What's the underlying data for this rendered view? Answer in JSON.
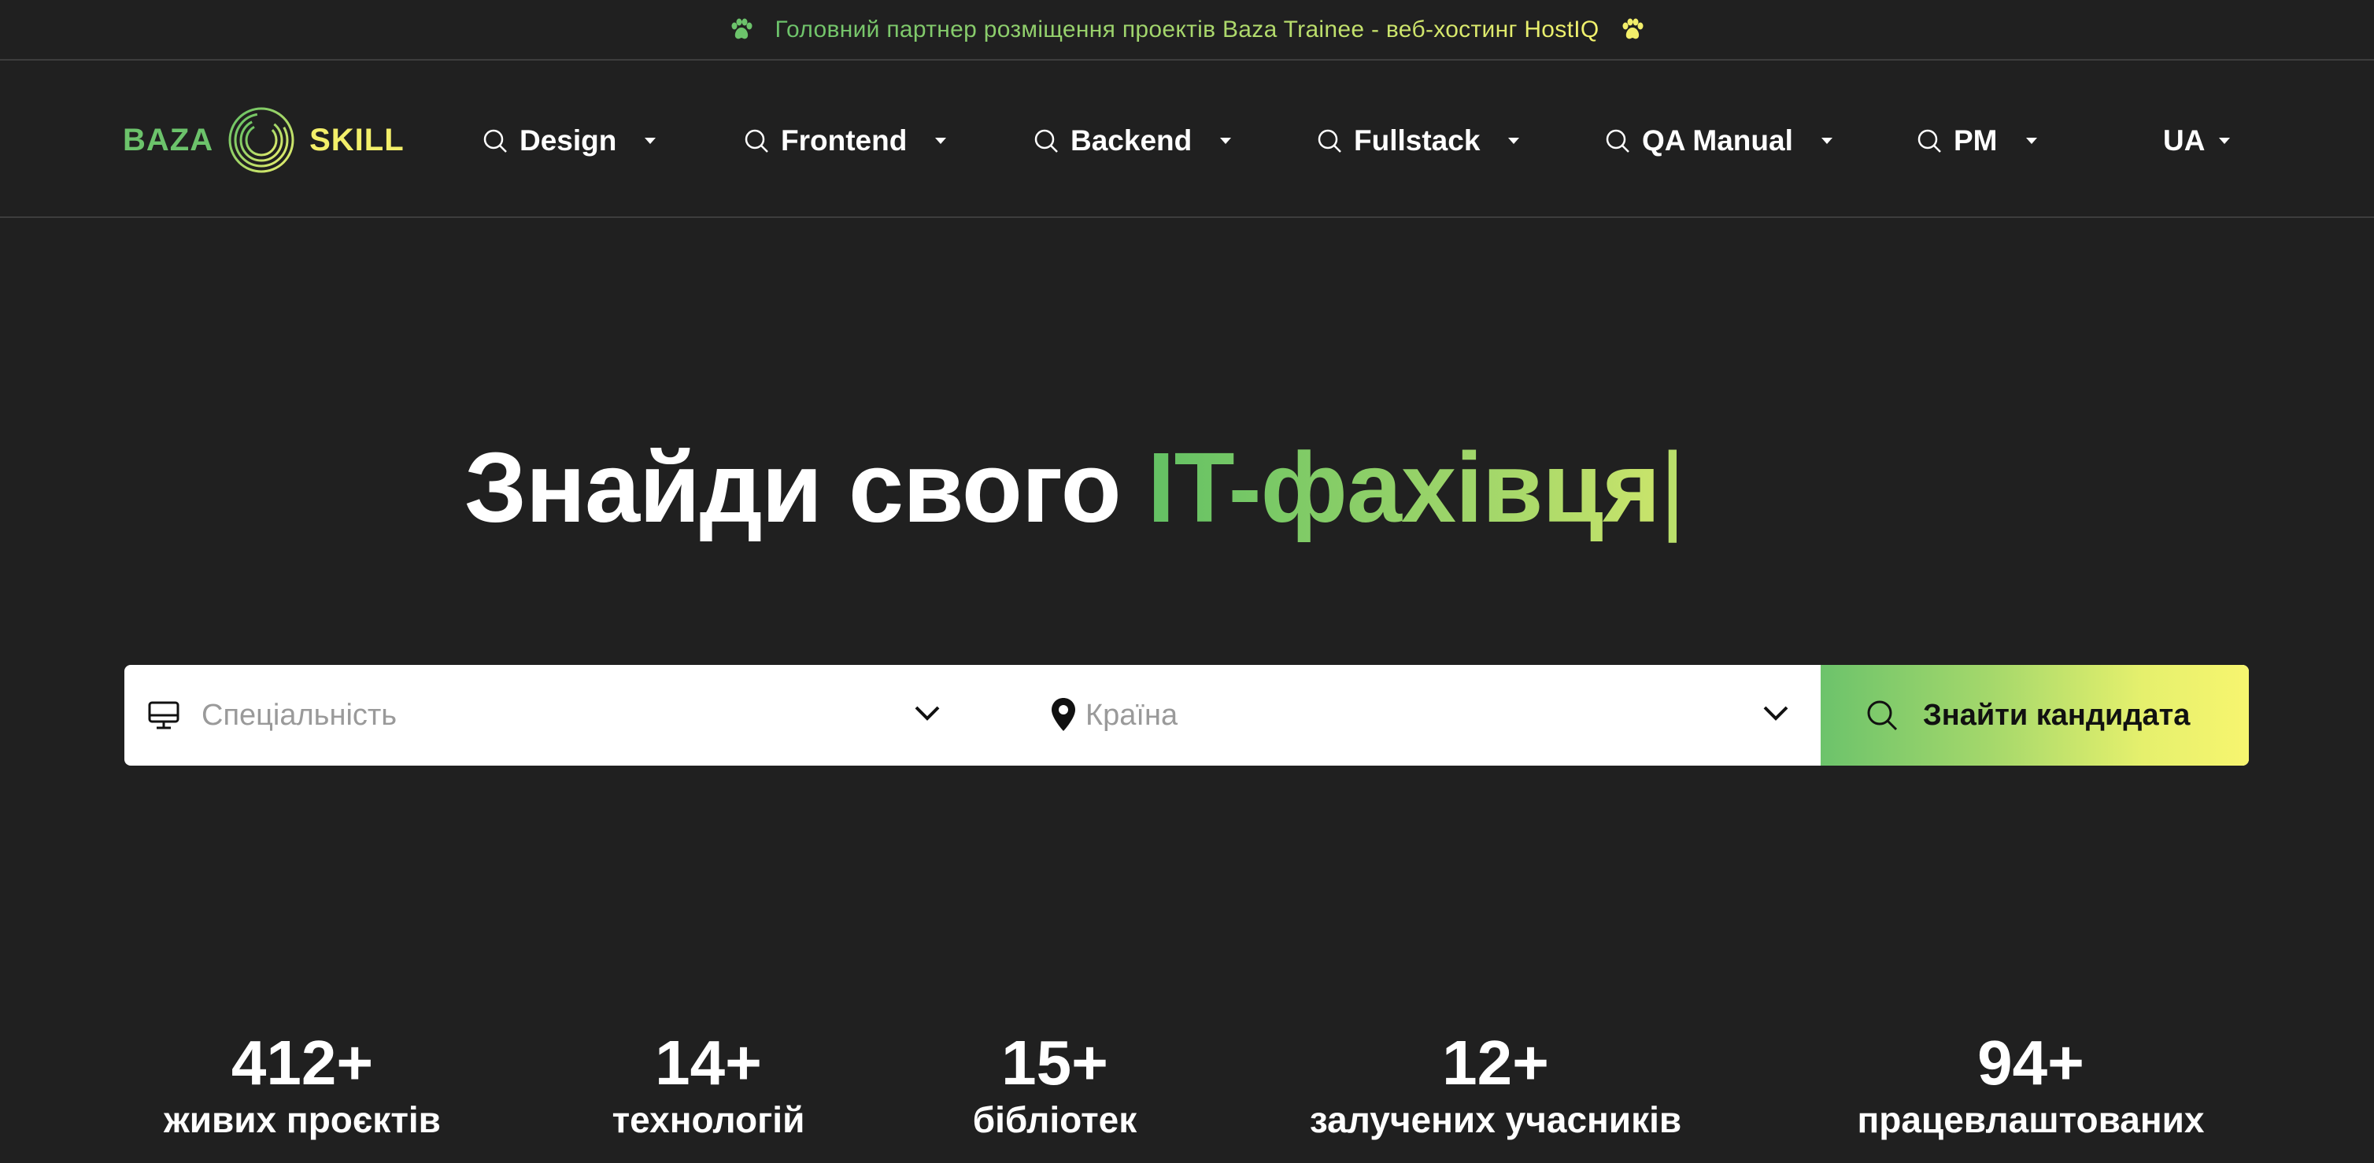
{
  "topbar": {
    "text": "Головний партнер розміщення проектів Baza Trainee - веб-хостинг HostIQ"
  },
  "logo": {
    "word1": "BAZA",
    "word2": "SKILL"
  },
  "nav": [
    {
      "label": "Design"
    },
    {
      "label": "Frontend"
    },
    {
      "label": "Backend"
    },
    {
      "label": "Fullstack"
    },
    {
      "label": "QA Manual"
    },
    {
      "label": "PM"
    }
  ],
  "lang": {
    "label": "UA"
  },
  "hero": {
    "text": "Знайди свого ",
    "accent": "IT-фахівця",
    "cursor": "|"
  },
  "search": {
    "specialty_placeholder": "Спеціальність",
    "country_placeholder": "Країна",
    "button_label": "Знайти кандидата"
  },
  "stats": [
    {
      "value": "412+",
      "label": "живих проєктів"
    },
    {
      "value": "14+",
      "label": "технологій"
    },
    {
      "value": "15+",
      "label": "бібліотек"
    },
    {
      "value": "12+",
      "label": "залучених учасників"
    },
    {
      "value": "94+",
      "label": "працевлаштованих"
    }
  ],
  "colors": {
    "background": "#202020",
    "green": "#6cc36b",
    "yellow": "#f3ef6a"
  }
}
